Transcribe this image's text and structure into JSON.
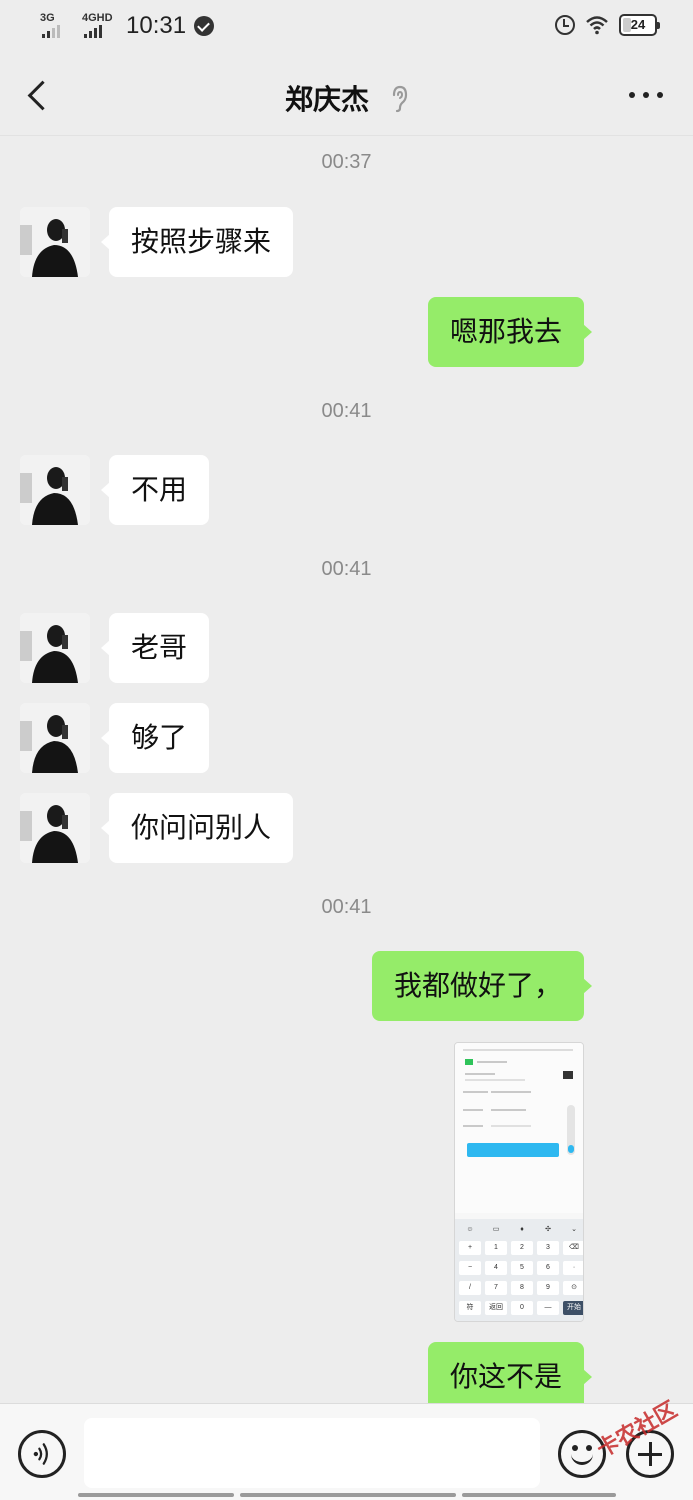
{
  "status_bar": {
    "network1": "3G",
    "network2": "4GHD",
    "time": "10:31",
    "battery": "24"
  },
  "header": {
    "title": "郑庆杰"
  },
  "messages": [
    {
      "type": "time",
      "text": "00:37"
    },
    {
      "type": "in",
      "text": "按照步骤来"
    },
    {
      "type": "out",
      "text": "嗯那我去"
    },
    {
      "type": "time",
      "text": "00:41"
    },
    {
      "type": "in",
      "text": "不用"
    },
    {
      "type": "time",
      "text": "00:41"
    },
    {
      "type": "in",
      "text": "老哥"
    },
    {
      "type": "in",
      "text": "够了"
    },
    {
      "type": "in",
      "text": "你问问别人"
    },
    {
      "type": "time",
      "text": "00:41"
    },
    {
      "type": "out",
      "text": "我都做好了，"
    },
    {
      "type": "out_image"
    },
    {
      "type": "out",
      "text": "你这不是"
    }
  ],
  "image_keypad": [
    "+",
    "1",
    "2",
    "3",
    "4",
    "5",
    "6",
    "7",
    "8",
    "9",
    "0"
  ],
  "input_bar": {
    "value": "",
    "watermark": "卡农社区"
  }
}
